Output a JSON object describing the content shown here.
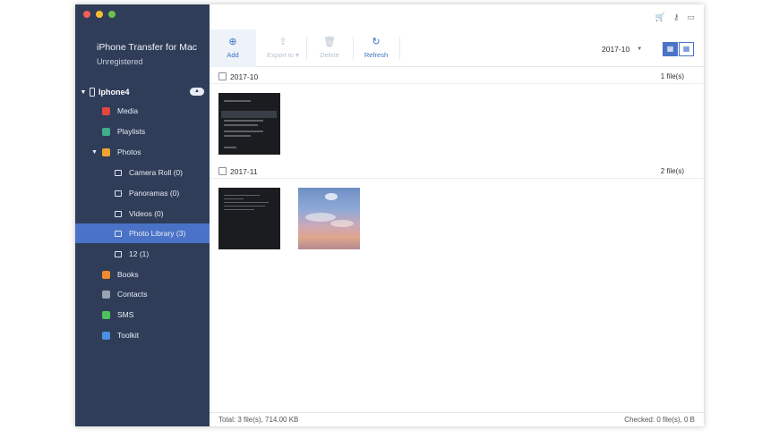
{
  "window": {
    "traffic_colors": [
      "#f25f58",
      "#f9be2e",
      "#6cc24a"
    ]
  },
  "sidebar": {
    "app_title": "iPhone Transfer for Mac",
    "registration": "Unregistered",
    "device_name": "Iphone4",
    "items": [
      {
        "label": "Media",
        "icon": "media-icon",
        "color": "#e2473f"
      },
      {
        "label": "Playlists",
        "icon": "playlist-icon",
        "color": "#3fae8d"
      },
      {
        "label": "Photos",
        "icon": "photos-icon",
        "color": "#f0a430"
      },
      {
        "label": "Camera Roll (0)",
        "icon": "camera-icon"
      },
      {
        "label": "Panoramas (0)",
        "icon": "camera-icon"
      },
      {
        "label": "Videos (0)",
        "icon": "camera-icon"
      },
      {
        "label": "Photo Library (3)",
        "icon": "album-icon"
      },
      {
        "label": "12 (1)",
        "icon": "album-icon"
      },
      {
        "label": "Books",
        "icon": "books-icon",
        "color": "#f08a2e"
      },
      {
        "label": "Contacts",
        "icon": "contacts-icon",
        "color": "#9aa3ad"
      },
      {
        "label": "SMS",
        "icon": "sms-icon",
        "color": "#4cc35a"
      },
      {
        "label": "Toolkit",
        "icon": "toolkit-icon",
        "color": "#4a8fe0"
      }
    ]
  },
  "toolbar": {
    "add": "Add",
    "export": "Export to",
    "delete": "Delete",
    "refresh": "Refresh",
    "date_value": "2017-10"
  },
  "groups": [
    {
      "date": "2017-10",
      "count": "1 file(s)"
    },
    {
      "date": "2017-11",
      "count": "2 file(s)"
    }
  ],
  "status": {
    "total": "Total: 3 file(s), 714.00 KB",
    "checked": "Checked: 0 file(s), 0 B"
  },
  "colors": {
    "sidebar_bg": "#2f3d59",
    "active_item": "#4a73c7",
    "accent": "#3d6fc4"
  }
}
